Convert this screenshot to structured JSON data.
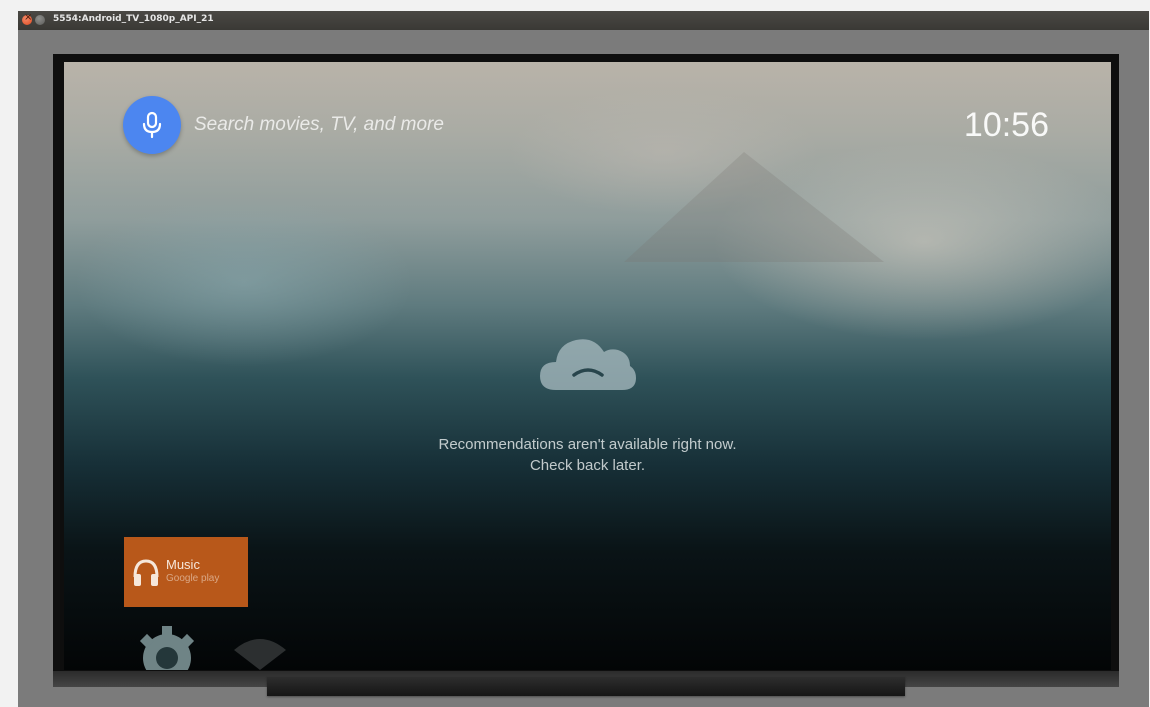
{
  "window": {
    "title": "5554:Android_TV_1080p_API_21"
  },
  "search": {
    "hint": "Search movies, TV, and more",
    "icon": "microphone-icon"
  },
  "status": {
    "clock": "10:56"
  },
  "recommendations": {
    "icon": "sad-cloud-icon",
    "line1": "Recommendations aren't available right now.",
    "line2": "Check back later."
  },
  "apps": [
    {
      "name": "Music",
      "store": "Google play",
      "icon": "headphones-icon",
      "color": "#b8581a"
    }
  ],
  "bottom_row": [
    {
      "icon": "settings-gear-icon"
    },
    {
      "icon": "network-icon"
    }
  ],
  "colors": {
    "mic_button": "#4c86f0",
    "music_tile": "#b8581a"
  }
}
